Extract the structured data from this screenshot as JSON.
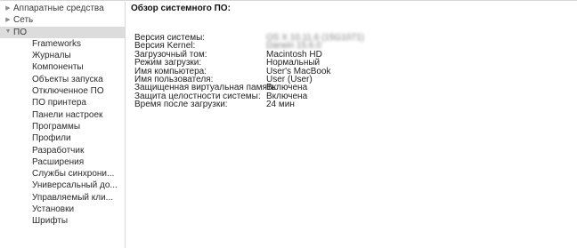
{
  "sidebar": {
    "items": [
      {
        "label": "Аппаратные средства",
        "level": "top",
        "expanded": false
      },
      {
        "label": "Сеть",
        "level": "top",
        "expanded": false
      },
      {
        "label": "ПО",
        "level": "top",
        "expanded": true,
        "selected": true
      },
      {
        "label": "Frameworks",
        "level": "child"
      },
      {
        "label": "Журналы",
        "level": "child"
      },
      {
        "label": "Компоненты",
        "level": "child"
      },
      {
        "label": "Объекты запуска",
        "level": "child"
      },
      {
        "label": "Отключенное ПО",
        "level": "child"
      },
      {
        "label": "ПО принтера",
        "level": "child"
      },
      {
        "label": "Панели настроек",
        "level": "child"
      },
      {
        "label": "Программы",
        "level": "child"
      },
      {
        "label": "Профили",
        "level": "child"
      },
      {
        "label": "Разработчик",
        "level": "child"
      },
      {
        "label": "Расширения",
        "level": "child"
      },
      {
        "label": "Службы синхрони...",
        "level": "child"
      },
      {
        "label": "Универсальный до...",
        "level": "child"
      },
      {
        "label": "Управляемый кли...",
        "level": "child"
      },
      {
        "label": "Установки",
        "level": "child"
      },
      {
        "label": "Шрифты",
        "level": "child"
      }
    ]
  },
  "content": {
    "heading": "Обзор системного ПО:",
    "rows": [
      {
        "label": "Версия системы:",
        "value": "OS X 10.11.6 (15G1071)",
        "blurred": true
      },
      {
        "label": "Версия Kernel:",
        "value": "Darwin 15.6.0",
        "blurred": true
      },
      {
        "label": "Загрузочный том:",
        "value": "Macintosh HD"
      },
      {
        "label": "Режим загрузки:",
        "value": "Нормальный"
      },
      {
        "label": "Имя компьютера:",
        "value": "User's MacBook"
      },
      {
        "label": "Имя пользователя:",
        "value": "User (User)"
      },
      {
        "label": "Защищенная виртуальная память:",
        "value": "Включена"
      },
      {
        "label": "Защита целостности системы:",
        "value": "Включена"
      },
      {
        "label": "Время после загрузки:",
        "value": "24 мин"
      }
    ]
  },
  "icons": {
    "collapsed": "disclosure-triangle-right-icon",
    "expanded": "disclosure-triangle-down-icon"
  },
  "colors": {
    "selection": "#dcdcdc",
    "divider": "#d9d9d9"
  }
}
